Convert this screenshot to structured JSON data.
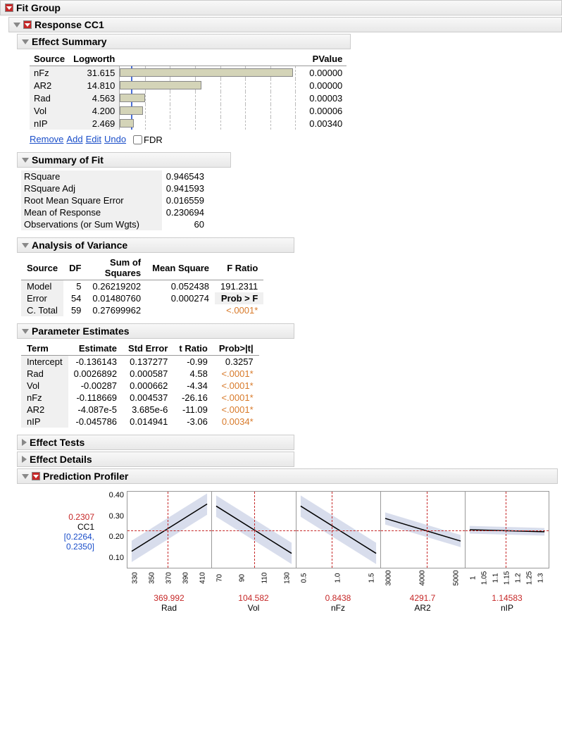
{
  "headers": {
    "fit_group": "Fit Group",
    "response": "Response CC1",
    "effect_summary": "Effect Summary",
    "summary_of_fit": "Summary of Fit",
    "anova": "Analysis of Variance",
    "param_est": "Parameter Estimates",
    "effect_tests": "Effect Tests",
    "effect_details": "Effect Details",
    "pred_profiler": "Prediction Profiler"
  },
  "effect_summary": {
    "cols": {
      "source": "Source",
      "logworth": "Logworth",
      "pvalue": "PValue"
    },
    "max_logworth": 32,
    "rows": [
      {
        "source": "nFz",
        "logworth": "31.615",
        "lw_num": 31.615,
        "pvalue": "0.00000"
      },
      {
        "source": "AR2",
        "logworth": "14.810",
        "lw_num": 14.81,
        "pvalue": "0.00000"
      },
      {
        "source": "Rad",
        "logworth": "4.563",
        "lw_num": 4.563,
        "pvalue": "0.00003"
      },
      {
        "source": "Vol",
        "logworth": "4.200",
        "lw_num": 4.2,
        "pvalue": "0.00006"
      },
      {
        "source": "nIP",
        "logworth": "2.469",
        "lw_num": 2.469,
        "pvalue": "0.00340"
      }
    ],
    "links": {
      "remove": "Remove",
      "add": "Add",
      "edit": "Edit",
      "undo": "Undo",
      "fdr": "FDR"
    }
  },
  "summary_of_fit": {
    "rows": [
      {
        "label": "RSquare",
        "value": "0.946543"
      },
      {
        "label": "RSquare Adj",
        "value": "0.941593"
      },
      {
        "label": "Root Mean Square Error",
        "value": "0.016559"
      },
      {
        "label": "Mean of Response",
        "value": "0.230694"
      },
      {
        "label": "Observations (or Sum Wgts)",
        "value": "60"
      }
    ]
  },
  "anova": {
    "cols": {
      "source": "Source",
      "df": "DF",
      "ss": "Sum of\nSquares",
      "ms": "Mean Square",
      "f": "F Ratio"
    },
    "rows": [
      {
        "source": "Model",
        "df": "5",
        "ss": "0.26219202",
        "ms": "0.052438",
        "f": "191.2311",
        "probf_label": ""
      },
      {
        "source": "Error",
        "df": "54",
        "ss": "0.01480760",
        "ms": "0.000274",
        "f": "",
        "probf_label": "Prob > F"
      },
      {
        "source": "C. Total",
        "df": "59",
        "ss": "0.27699962",
        "ms": "",
        "f": "",
        "probf": "<.0001*"
      }
    ]
  },
  "param_est": {
    "cols": {
      "term": "Term",
      "est": "Estimate",
      "se": "Std Error",
      "t": "t Ratio",
      "p": "Prob>|t|"
    },
    "rows": [
      {
        "term": "Intercept",
        "est": "-0.136143",
        "se": "0.137277",
        "t": "-0.99",
        "p": "0.3257",
        "sig": false
      },
      {
        "term": "Rad",
        "est": "0.0026892",
        "se": "0.000587",
        "t": "4.58",
        "p": "<.0001*",
        "sig": true
      },
      {
        "term": "Vol",
        "est": "-0.00287",
        "se": "0.000662",
        "t": "-4.34",
        "p": "<.0001*",
        "sig": true
      },
      {
        "term": "nFz",
        "est": "-0.118669",
        "se": "0.004537",
        "t": "-26.16",
        "p": "<.0001*",
        "sig": true
      },
      {
        "term": "AR2",
        "est": "-4.087e-5",
        "se": "3.685e-6",
        "t": "-11.09",
        "p": "<.0001*",
        "sig": true
      },
      {
        "term": "nIP",
        "est": "-0.045786",
        "se": "0.014941",
        "t": "-3.06",
        "p": "0.0034*",
        "sig": true
      }
    ]
  },
  "profiler": {
    "y_label": "CC1",
    "y_pred": "0.2307",
    "y_ci": "[0.2264,\n0.2350]",
    "y_ticks": [
      "0.10",
      "0.20",
      "0.30",
      "0.40"
    ],
    "y_range": [
      0.05,
      0.42
    ],
    "cross_y": 0.2307,
    "factors": [
      {
        "name": "Rad",
        "value": "369.992",
        "ticks": [
          "330",
          "350",
          "370",
          "390",
          "410"
        ],
        "slope": "up",
        "cross_x_pct": 48
      },
      {
        "name": "Vol",
        "value": "104.582",
        "ticks": [
          "70",
          "90",
          "110",
          "130"
        ],
        "slope": "down",
        "cross_x_pct": 50
      },
      {
        "name": "nFz",
        "value": "0.8438",
        "ticks": [
          "0.5",
          "1.0",
          "1.5"
        ],
        "slope": "down",
        "cross_x_pct": 42
      },
      {
        "name": "AR2",
        "value": "4291.7",
        "ticks": [
          "3000",
          "4000",
          "5000"
        ],
        "slope": "down_mild",
        "cross_x_pct": 55
      },
      {
        "name": "nIP",
        "value": "1.14583",
        "ticks": [
          "1",
          "1.05",
          "1.1",
          "1.15",
          "1.2",
          "1.25",
          "1.3"
        ],
        "slope": "flat",
        "cross_x_pct": 48
      }
    ]
  },
  "chart_data": {
    "type": "bar",
    "title": "Effect Summary Logworth",
    "categories": [
      "nFz",
      "AR2",
      "Rad",
      "Vol",
      "nIP"
    ],
    "values": [
      31.615,
      14.81,
      4.563,
      4.2,
      2.469
    ],
    "xlabel": "Logworth",
    "ylabel": "Source",
    "xlim": [
      0,
      32
    ]
  }
}
